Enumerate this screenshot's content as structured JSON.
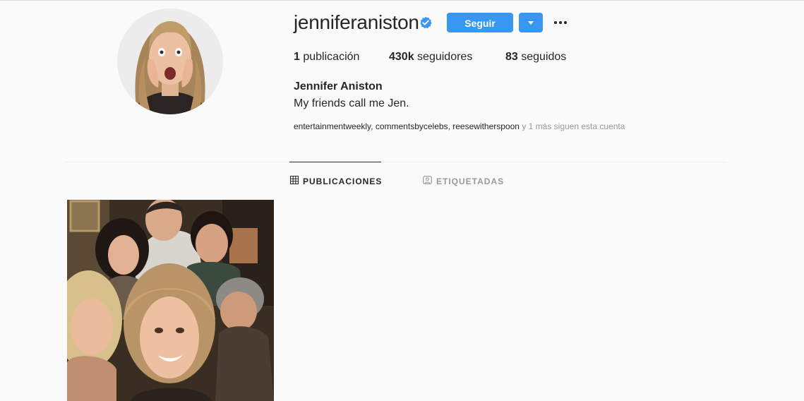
{
  "profile": {
    "username": "jenniferaniston",
    "full_name": "Jennifer Aniston",
    "bio": "My friends call me Jen.",
    "verified_icon": "verified-badge-icon"
  },
  "actions": {
    "follow_label": "Seguir",
    "dropdown_icon": "chevron-down-icon",
    "more_icon": "more-options-icon"
  },
  "stats": {
    "posts_count": "1",
    "posts_label": "publicación",
    "followers_count": "430k",
    "followers_label": "seguidores",
    "following_count": "83",
    "following_label": "seguidos"
  },
  "followed_by": {
    "accounts": [
      "entertainmentweekly",
      "commentsbycelebs",
      "reesewitherspoon"
    ],
    "more_text": "y 1 más siguen esta cuenta"
  },
  "tabs": [
    {
      "label": "PUBLICACIONES",
      "icon": "grid-icon",
      "active": true
    },
    {
      "label": "ETIQUETADAS",
      "icon": "tagged-icon",
      "active": false
    }
  ],
  "colors": {
    "accent": "#3897f0",
    "text": "#262626",
    "muted": "#999999",
    "background": "#fafafa"
  }
}
